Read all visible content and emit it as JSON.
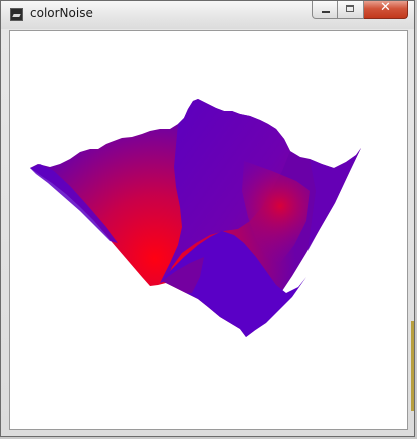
{
  "window": {
    "title": "colorNoise",
    "close_glyph": "✕"
  },
  "icons": {
    "app": "app-window-icon",
    "minimize": "minimize-icon",
    "maximize": "maximize-icon",
    "close": "close-icon"
  },
  "colors": {
    "surface_low": "#ff0010",
    "surface_high": "#4a00c8",
    "canvas_bg": "#ffffff"
  }
}
